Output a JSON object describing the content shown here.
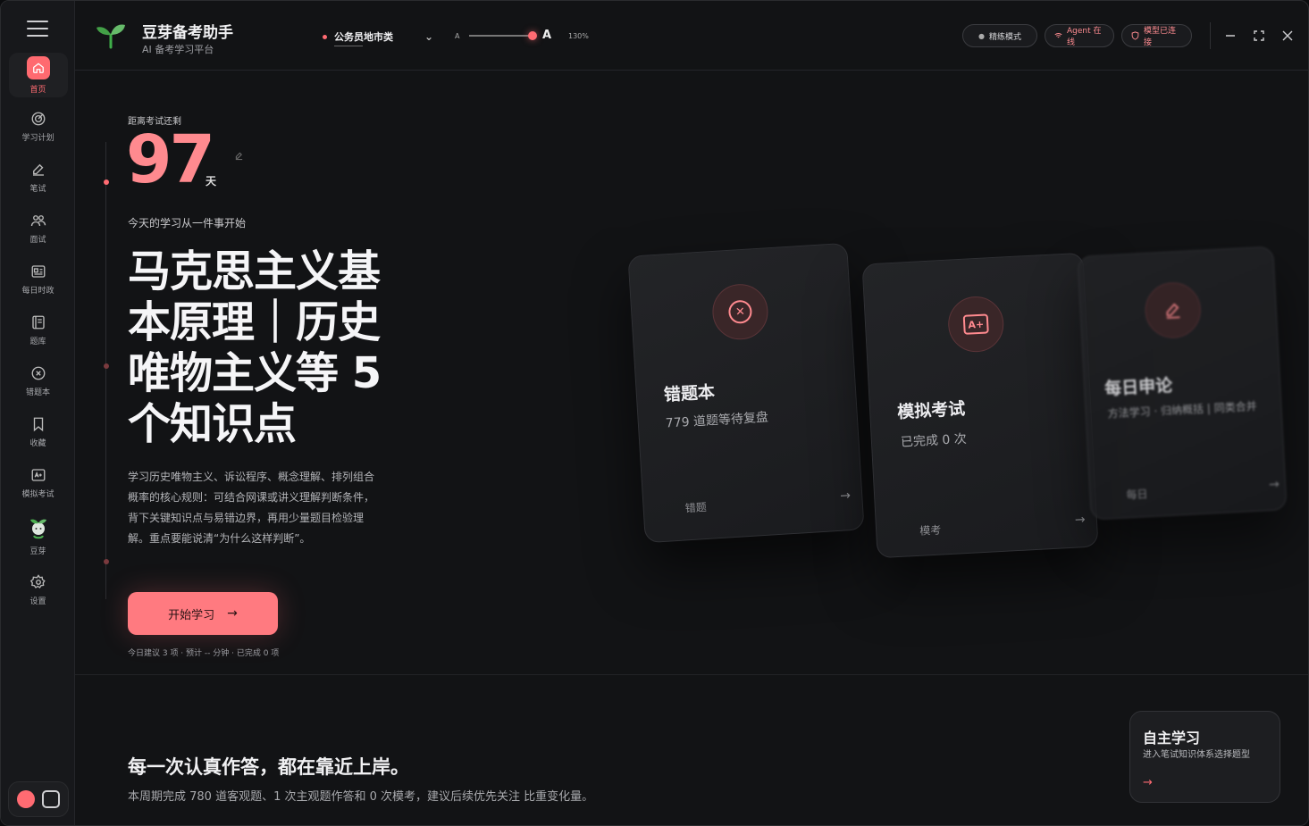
{
  "app": {
    "title": "豆芽备考助手",
    "subtitle": "AI 备考学习平台"
  },
  "sidebar": {
    "items": [
      {
        "label": "首页",
        "icon": "home-icon",
        "active": true
      },
      {
        "label": "学习计划",
        "icon": "target-icon"
      },
      {
        "label": "笔试",
        "icon": "pen-icon"
      },
      {
        "label": "面试",
        "icon": "people-icon"
      },
      {
        "label": "每日时政",
        "icon": "news-icon"
      },
      {
        "label": "题库",
        "icon": "book-icon"
      },
      {
        "label": "错题本",
        "icon": "x-circle-icon"
      },
      {
        "label": "收藏",
        "icon": "bookmark-icon"
      },
      {
        "label": "模拟考试",
        "icon": "exam-icon"
      },
      {
        "label": "豆芽",
        "icon": "sprout-icon"
      },
      {
        "label": "设置",
        "icon": "gear-icon"
      }
    ]
  },
  "topbar": {
    "exam_category": "公务员地市类",
    "font_small": "A",
    "font_large": "A",
    "zoom": "130%",
    "font_scale_level": 0.95,
    "pills": [
      {
        "label": "精练模式"
      },
      {
        "label": "Agent 在线"
      },
      {
        "label": "模型已连接"
      }
    ]
  },
  "hero": {
    "countdown_label": "距离考试还剩",
    "days": "97",
    "days_unit": "天",
    "today_start": "今天的学习从一件事开始",
    "headline": "马克思主义基本原理｜历史唯物主义等 5 个知识点",
    "description": "学习历史唯物主义、诉讼程序、概念理解、排列组合概率的核心规则：可结合网课或讲义理解判断条件，背下关键知识点与易错边界，再用少量题目检验理解。重点要能说清“为什么这样判断”。",
    "start_button": "开始学习",
    "today_meta": "今日建议 3 项 · 预计 -- 分钟 · 已完成 0 项"
  },
  "cards": [
    {
      "title": "错题本",
      "subtitle": "779 道题等待复盘",
      "tag": "错题",
      "icon": "x-circle-icon"
    },
    {
      "title": "模拟考试",
      "subtitle": "已完成 0 次",
      "tag": "模考",
      "icon": "exam-icon"
    },
    {
      "title": "每日申论",
      "subtitle": "方法学习 · 归纳概括 | 同类合并",
      "tag": "每日",
      "icon": "pen-icon"
    }
  ],
  "bottom": {
    "motto": "每一次认真作答，都在靠近上岸。",
    "weekly": "本周期完成 780 道客观题、1 次主观题作答和 0 次模考，建议后续优先关注 比重变化量。"
  },
  "self_study": {
    "title": "自主学习",
    "subtitle": "进入笔试知识体系选择题型"
  },
  "colors": {
    "accent": "#ff6b72",
    "background": "#121315",
    "sidebar": "#17181b"
  }
}
